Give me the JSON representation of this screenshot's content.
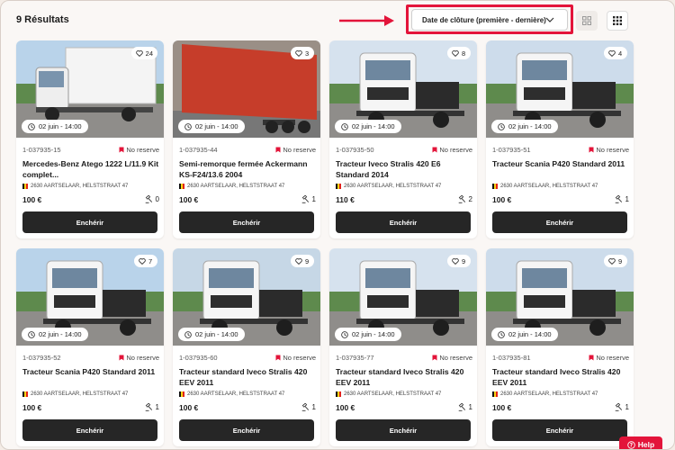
{
  "header": {
    "results_count": "9 Résultats",
    "sort_label": "Date de clôture (première - dernière)"
  },
  "colors": {
    "accent": "#e3143a",
    "button": "#262626"
  },
  "cards": [
    {
      "likes": "24",
      "date": "02 juin - 14:00",
      "lot": "1-037935-15",
      "reserve": "No reserve",
      "title": "Mercedes-Benz Atego 1222 L/11.9 Kit complet...",
      "location": "2630 AARTSELAAR, HELSTSTRAAT 47",
      "price": "100 €",
      "bids": "0",
      "button": "Enchérir",
      "kind": "box-truck"
    },
    {
      "likes": "3",
      "date": "02 juin - 14:00",
      "lot": "1-037935-44",
      "reserve": "No reserve",
      "title": "Semi-remorque fermée Ackermann KS-F24/13.6 2004",
      "location": "2630 AARTSELAAR, HELSTSTRAAT 47",
      "price": "100 €",
      "bids": "1",
      "button": "Enchérir",
      "kind": "trailer"
    },
    {
      "likes": "8",
      "date": "02 juin - 14:00",
      "lot": "1-037935-50",
      "reserve": "No reserve",
      "title": "Tracteur Iveco Stralis 420 E6 Standard 2014",
      "location": "2630 AARTSELAAR, HELSTSTRAAT 47",
      "price": "110 €",
      "bids": "2",
      "button": "Enchérir",
      "kind": "tractor"
    },
    {
      "likes": "4",
      "date": "02 juin - 14:00",
      "lot": "1-037935-51",
      "reserve": "No reserve",
      "title": "Tracteur Scania P420 Standard 2011",
      "location": "2630 AARTSELAAR, HELSTSTRAAT 47",
      "price": "100 €",
      "bids": "1",
      "button": "Enchérir",
      "kind": "tractor"
    },
    {
      "likes": "7",
      "date": "02 juin - 14:00",
      "lot": "1-037935-52",
      "reserve": "No reserve",
      "title": "Tracteur Scania P420 Standard 2011",
      "location": "2630 AARTSELAAR, HELSTSTRAAT 47",
      "price": "100 €",
      "bids": "1",
      "button": "Enchérir",
      "kind": "tractor"
    },
    {
      "likes": "9",
      "date": "02 juin - 14:00",
      "lot": "1-037935-60",
      "reserve": "No reserve",
      "title": "Tracteur standard Iveco Stralis 420 EEV 2011",
      "location": "2630 AARTSELAAR, HELSTSTRAAT 47",
      "price": "100 €",
      "bids": "1",
      "button": "Enchérir",
      "kind": "tractor"
    },
    {
      "likes": "9",
      "date": "02 juin - 14:00",
      "lot": "1-037935-77",
      "reserve": "No reserve",
      "title": "Tracteur standard Iveco Stralis 420 EEV 2011",
      "location": "2630 AARTSELAAR, HELSTSTRAAT 47",
      "price": "100 €",
      "bids": "1",
      "button": "Enchérir",
      "kind": "tractor"
    },
    {
      "likes": "9",
      "date": "02 juin - 14:00",
      "lot": "1-037935-81",
      "reserve": "No reserve",
      "title": "Tracteur standard Iveco Stralis 420 EEV 2011",
      "location": "2630 AARTSELAAR, HELSTSTRAAT 47",
      "price": "100 €",
      "bids": "1",
      "button": "Enchérir",
      "kind": "tractor"
    }
  ],
  "help": {
    "label": "Help"
  }
}
